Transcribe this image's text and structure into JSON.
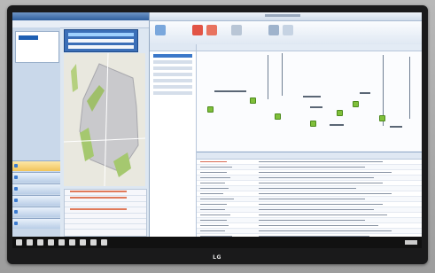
{
  "brand": {
    "label": "LG"
  },
  "colors": {
    "accent": "#3b78c9",
    "node_green": "#7fbf3a",
    "alert_red": "#d96b55"
  },
  "icons": {
    "start": "windows-start-icon",
    "close": "close-icon"
  }
}
